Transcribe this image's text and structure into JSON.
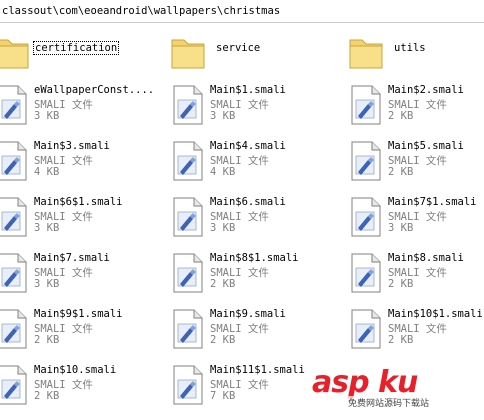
{
  "path": "classout\\com\\eoeandroid\\wallpapers\\christmas",
  "folders": [
    {
      "name": "certification"
    },
    {
      "name": "service"
    },
    {
      "name": "utils"
    }
  ],
  "files": [
    {
      "name": "eWallpaperConst....",
      "type": "SMALI 文件",
      "size": "3 KB"
    },
    {
      "name": "Main$1.smali",
      "type": "SMALI 文件",
      "size": "3 KB"
    },
    {
      "name": "Main$2.smali",
      "type": "SMALI 文件",
      "size": "2 KB"
    },
    {
      "name": "Main$3.smali",
      "type": "SMALI 文件",
      "size": "4 KB"
    },
    {
      "name": "Main$4.smali",
      "type": "SMALI 文件",
      "size": "4 KB"
    },
    {
      "name": "Main$5.smali",
      "type": "SMALI 文件",
      "size": "2 KB"
    },
    {
      "name": "Main$6$1.smali",
      "type": "SMALI 文件",
      "size": "3 KB"
    },
    {
      "name": "Main$6.smali",
      "type": "SMALI 文件",
      "size": "3 KB"
    },
    {
      "name": "Main$7$1.smali",
      "type": "SMALI 文件",
      "size": "3 KB"
    },
    {
      "name": "Main$7.smali",
      "type": "SMALI 文件",
      "size": "3 KB"
    },
    {
      "name": "Main$8$1.smali",
      "type": "SMALI 文件",
      "size": "2 KB"
    },
    {
      "name": "Main$8.smali",
      "type": "SMALI 文件",
      "size": "2 KB"
    },
    {
      "name": "Main$9$1.smali",
      "type": "SMALI 文件",
      "size": "2 KB"
    },
    {
      "name": "Main$9.smali",
      "type": "SMALI 文件",
      "size": "2 KB"
    },
    {
      "name": "Main$10$1.smali",
      "type": "SMALI 文件",
      "size": "2 KB"
    },
    {
      "name": "Main$10.smali",
      "type": "SMALI 文件",
      "size": "2 KB"
    },
    {
      "name": "Main$11$1.smali",
      "type": "SMALI 文件",
      "size": "7 KB"
    },
    {
      "name": "",
      "type": "",
      "size": ""
    }
  ],
  "watermark": {
    "main": "asp ku",
    "sub": "免费网站源码下载站"
  }
}
